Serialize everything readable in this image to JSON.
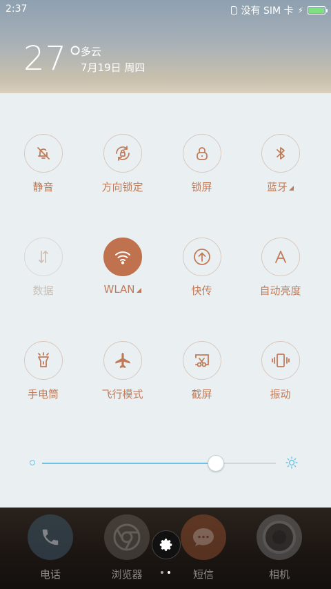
{
  "status_bar": {
    "time": "2:37",
    "sim_text": "没有 SIM 卡"
  },
  "weather": {
    "temperature": "27°",
    "condition": "多云",
    "date": "7月19日 周四"
  },
  "toggles": [
    {
      "label": "静音",
      "icon": "bell-off-icon",
      "state": "off"
    },
    {
      "label": "方向锁定",
      "icon": "rotation-lock-icon",
      "state": "off"
    },
    {
      "label": "锁屏",
      "icon": "lock-icon",
      "state": "off"
    },
    {
      "label": "蓝牙",
      "icon": "bluetooth-icon",
      "state": "off",
      "has_more": true
    },
    {
      "label": "数据",
      "icon": "mobile-data-icon",
      "state": "disabled"
    },
    {
      "label": "WLAN",
      "icon": "wifi-icon",
      "state": "on",
      "has_more": true
    },
    {
      "label": "快传",
      "icon": "quick-transfer-icon",
      "state": "off"
    },
    {
      "label": "自动亮度",
      "icon": "auto-brightness-icon",
      "state": "off"
    },
    {
      "label": "手电筒",
      "icon": "flashlight-icon",
      "state": "off"
    },
    {
      "label": "飞行模式",
      "icon": "airplane-icon",
      "state": "off"
    },
    {
      "label": "截屏",
      "icon": "screenshot-icon",
      "state": "off"
    },
    {
      "label": "振动",
      "icon": "vibrate-icon",
      "state": "off"
    }
  ],
  "brightness": {
    "level": 0.74
  },
  "dock": {
    "apps": [
      {
        "label": "电话",
        "icon": "phone-icon"
      },
      {
        "label": "浏览器",
        "icon": "browser-icon"
      },
      {
        "label": "短信",
        "icon": "message-icon"
      },
      {
        "label": "相机",
        "icon": "camera-icon"
      }
    ],
    "settings_icon": "gear-icon",
    "page_indicator": {
      "count": 2,
      "current": 2
    }
  },
  "colors": {
    "accent": "#c0714d",
    "slider": "#6cc4e4",
    "panel_bg": "#eaf0f2"
  }
}
